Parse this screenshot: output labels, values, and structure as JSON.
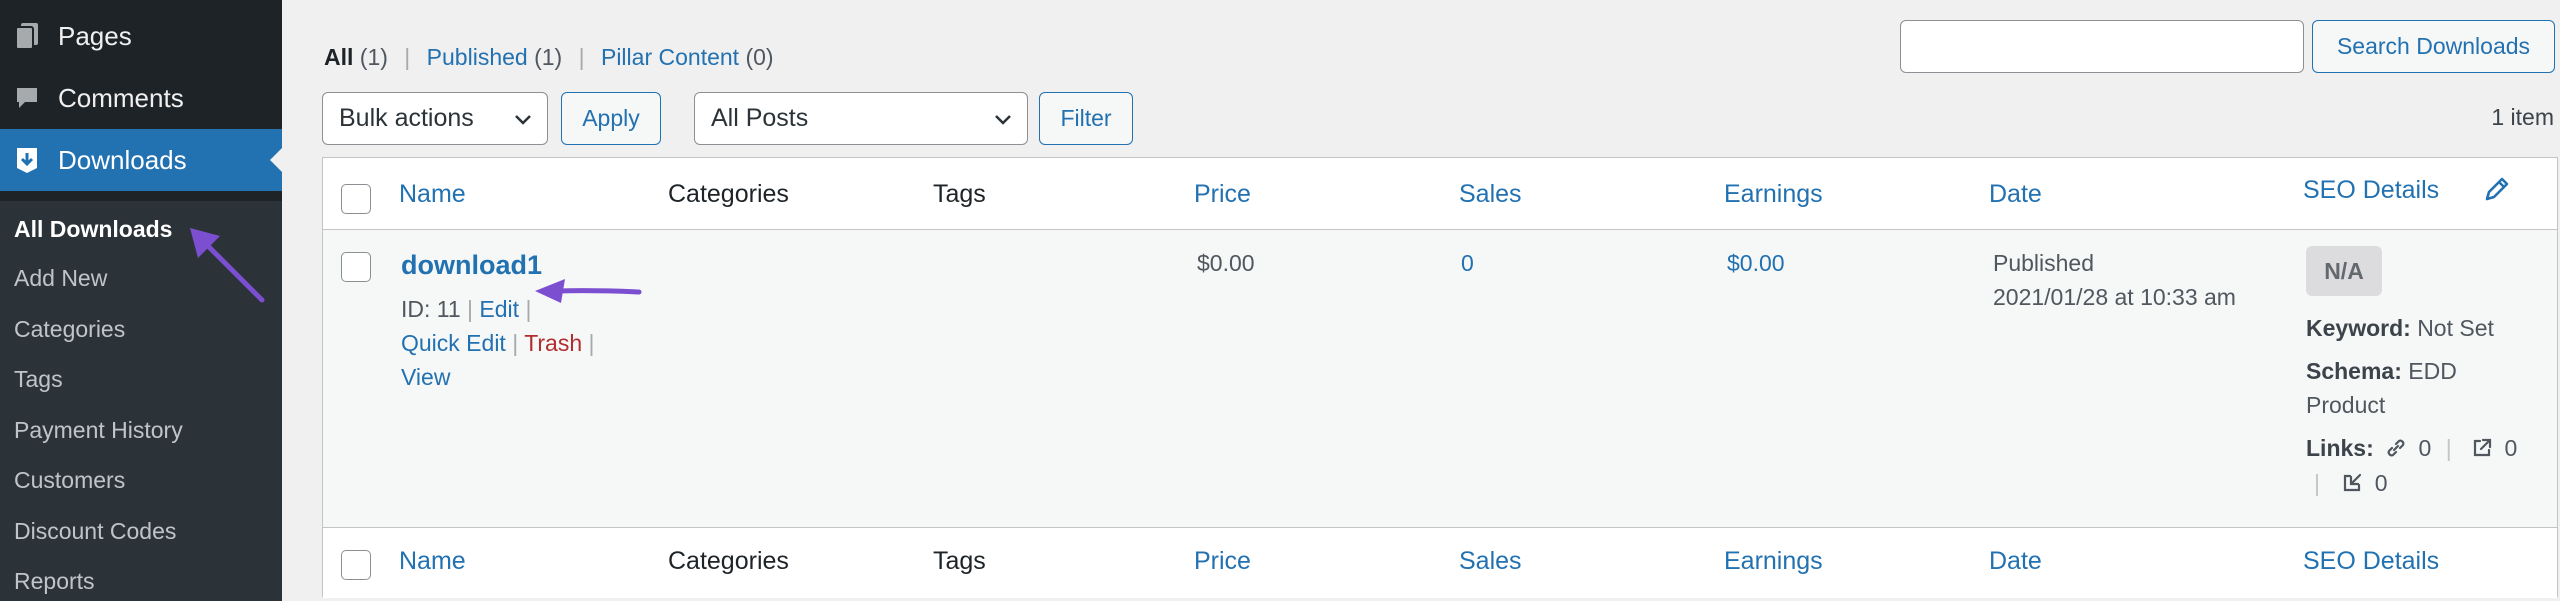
{
  "sidebar": {
    "menu": [
      {
        "label": "Pages",
        "icon": "pages-icon"
      },
      {
        "label": "Comments",
        "icon": "comments-icon"
      },
      {
        "label": "Downloads",
        "icon": "downloads-icon"
      }
    ],
    "submenu": [
      "All Downloads",
      "Add New",
      "Categories",
      "Tags",
      "Payment History",
      "Customers",
      "Discount Codes",
      "Reports"
    ],
    "colors": {
      "bg": "#1d2327",
      "current": "#2271b1",
      "submenu_bg": "#2c3338"
    }
  },
  "views": {
    "all": {
      "label": "All",
      "count": "(1)"
    },
    "published": {
      "label": "Published",
      "count": "(1)"
    },
    "pillar": {
      "label": "Pillar Content",
      "count": "(0)"
    },
    "separator": "|"
  },
  "search": {
    "value": "",
    "button": "Search Downloads"
  },
  "bulk": {
    "selected": "Bulk actions",
    "apply": "Apply"
  },
  "filter": {
    "selected": "All Posts",
    "button": "Filter"
  },
  "items_count": "1 item",
  "columns": {
    "name": "Name",
    "categories": "Categories",
    "tags": "Tags",
    "price": "Price",
    "sales": "Sales",
    "earnings": "Earnings",
    "date": "Date",
    "seo": "SEO Details"
  },
  "row": {
    "title": "download1",
    "id_text": "ID: 11",
    "sep": "|",
    "edit": "Edit",
    "quick_edit": "Quick Edit",
    "trash": "Trash",
    "view": "View",
    "price": "$0.00",
    "sales": "0",
    "earnings": "$0.00",
    "date_status": "Published",
    "date_value": "2021/01/28 at 10:33 am",
    "seo": {
      "score": "N/A",
      "keyword_label": "Keyword:",
      "keyword_value": "Not Set",
      "schema_label": "Schema:",
      "schema_value_1": "EDD",
      "schema_value_2": "Product",
      "links_label": "Links:",
      "internal": "0",
      "external": "0",
      "incoming": "0",
      "sep": "|"
    }
  },
  "accent": {
    "link": "#2271b1",
    "annotation_arrow": "#7b4fcf",
    "trash": "#b32d2e"
  }
}
